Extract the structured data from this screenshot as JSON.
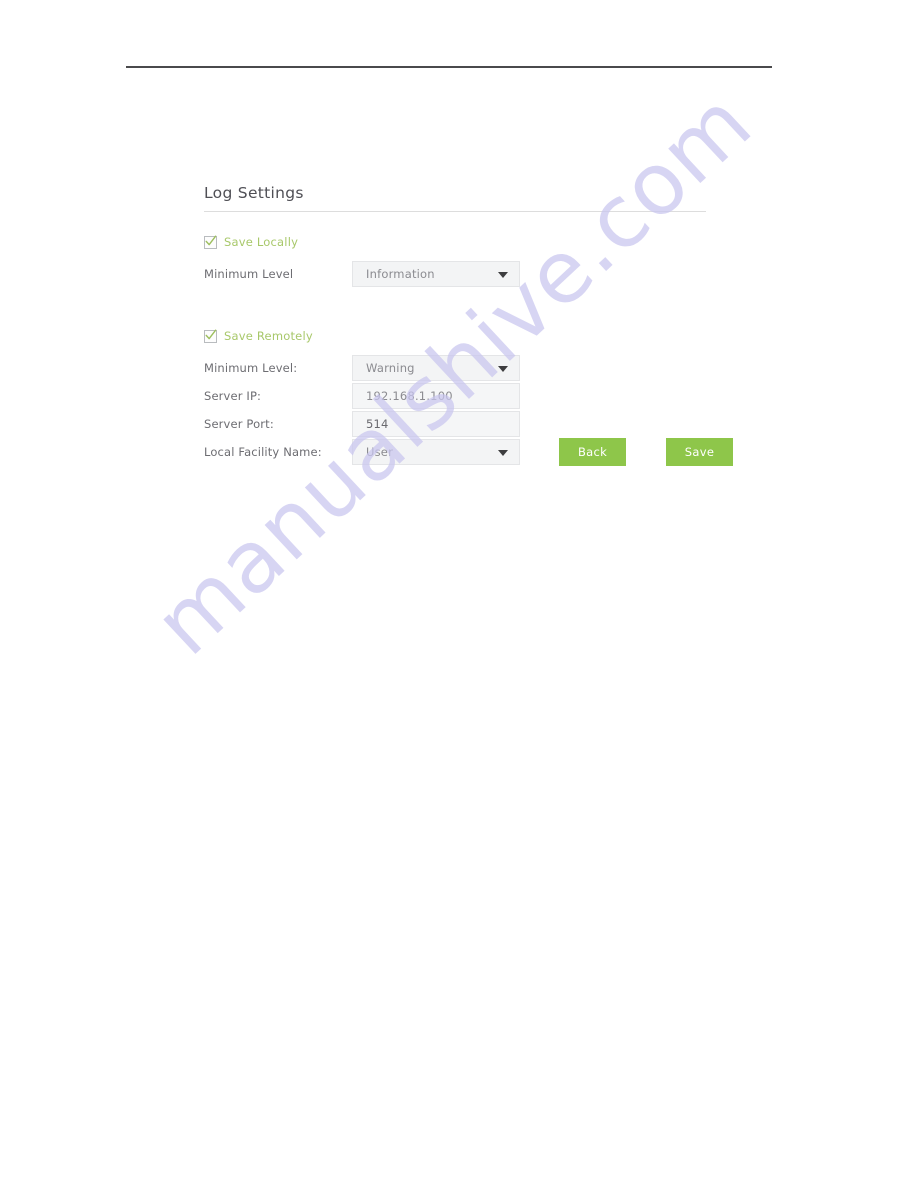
{
  "page": {
    "watermark": "manualshive.com",
    "watermark_color": "#c9c6ef",
    "rule_color": "#4a4a4c"
  },
  "panel": {
    "title": "Log Settings",
    "accent_green": "#a8c86a",
    "button_green": "#8ec64a",
    "checks": [
      {
        "name": "save-locally",
        "label": "Save Locally",
        "checked": true
      },
      {
        "name": "save-remotely",
        "label": "Save Remotely",
        "checked": true
      }
    ],
    "fields": [
      {
        "name": "minimum-level-local",
        "label": "Minimum Level",
        "value": "Information",
        "control": "select"
      },
      {
        "name": "minimum-level-remote",
        "label": "Minimum Level:",
        "value": "Warning",
        "control": "select"
      },
      {
        "name": "server-ip",
        "label": "Server IP:",
        "value": "192.168.1.100",
        "control": "text"
      },
      {
        "name": "server-port",
        "label": "Server Port:",
        "value": "514",
        "control": "text"
      },
      {
        "name": "local-facility-name",
        "label": "Local Facility Name:",
        "value": "User",
        "control": "select"
      }
    ],
    "buttons": {
      "back": "Back",
      "save": "Save"
    }
  }
}
